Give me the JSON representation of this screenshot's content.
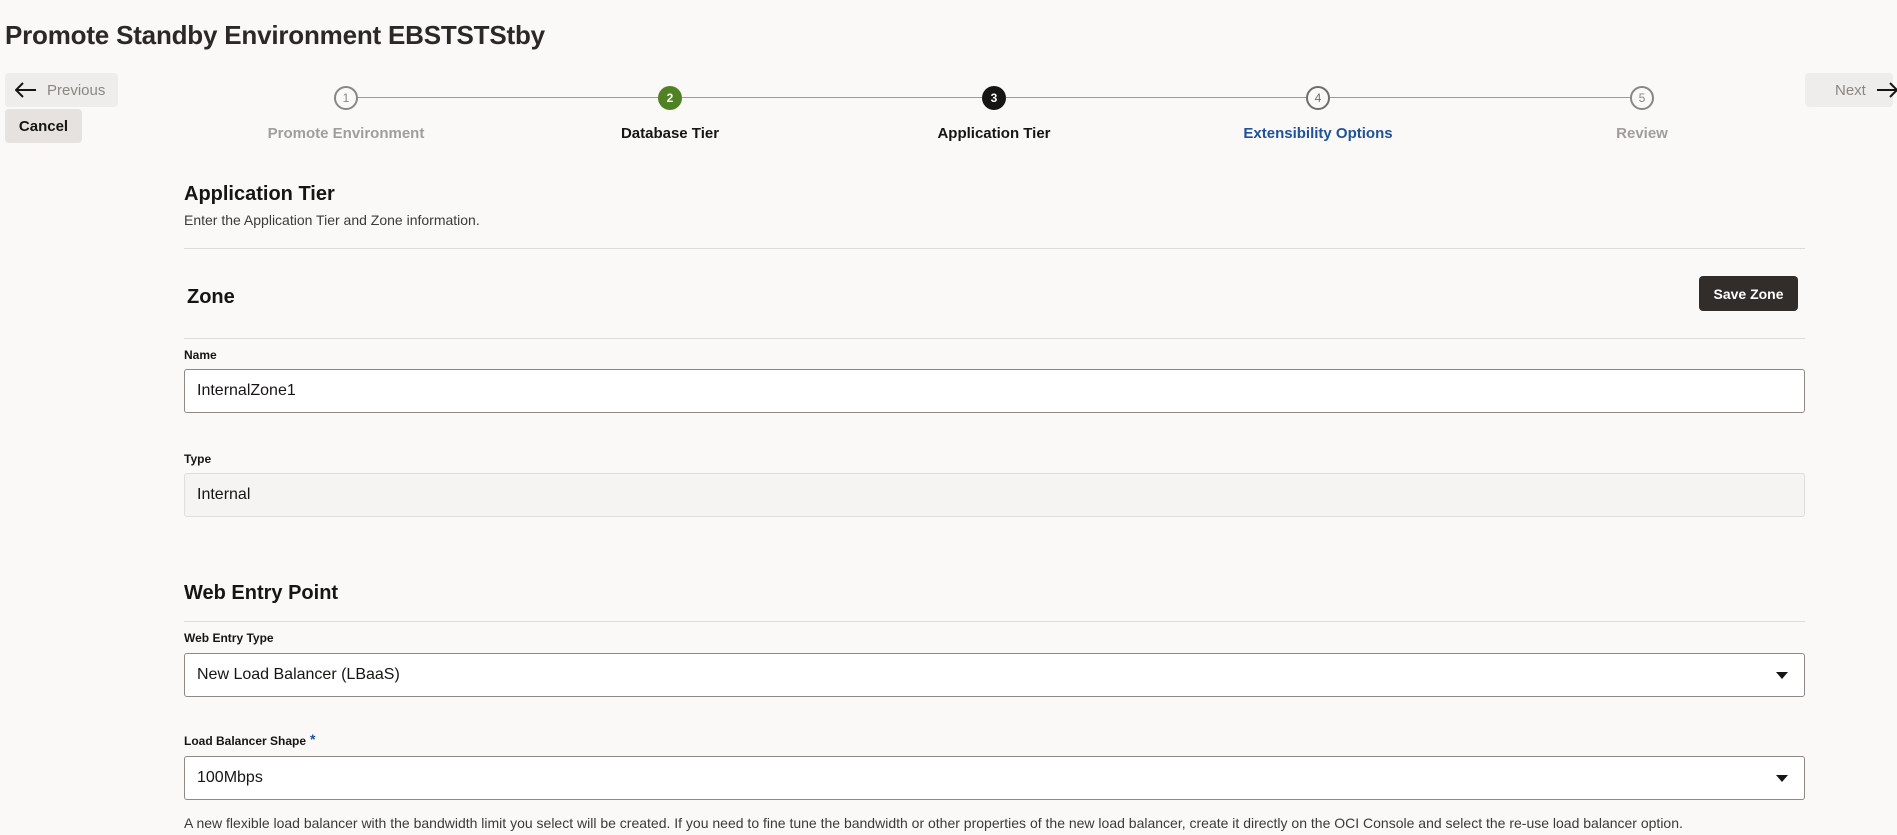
{
  "page": {
    "title": "Promote Standby Environment EBSTSTStby"
  },
  "nav": {
    "previous_label": "Previous",
    "next_label": "Next",
    "cancel_label": "Cancel"
  },
  "stepper": {
    "steps": [
      {
        "number": "1",
        "label": "Promote Environment",
        "state": "visited"
      },
      {
        "number": "2",
        "label": "Database Tier",
        "state": "complete"
      },
      {
        "number": "3",
        "label": "Application Tier",
        "state": "current"
      },
      {
        "number": "4",
        "label": "Extensibility Options",
        "state": "next"
      },
      {
        "number": "5",
        "label": "Review",
        "state": "disabled"
      }
    ]
  },
  "app_tier": {
    "title": "Application Tier",
    "description": "Enter the Application Tier and Zone information."
  },
  "zone": {
    "title": "Zone",
    "save_label": "Save Zone",
    "name_label": "Name",
    "name_value": "InternalZone1",
    "type_label": "Type",
    "type_value": "Internal"
  },
  "web_entry": {
    "title": "Web Entry Point",
    "type_label": "Web Entry Type",
    "type_value": "New Load Balancer (LBaaS)",
    "shape_label": "Load Balancer Shape",
    "required_mark": "*",
    "shape_value": "100Mbps",
    "help_text": "A new flexible load balancer with the bandwidth limit you select will be created. If you need to fine tune the bandwidth or other properties of the new load balancer, create it directly on the OCI Console and select the re-use load balancer option."
  },
  "colors": {
    "complete_step": "#508223",
    "current_step": "#161513",
    "link_blue": "#1f5297",
    "primary_button": "#312d2a"
  }
}
